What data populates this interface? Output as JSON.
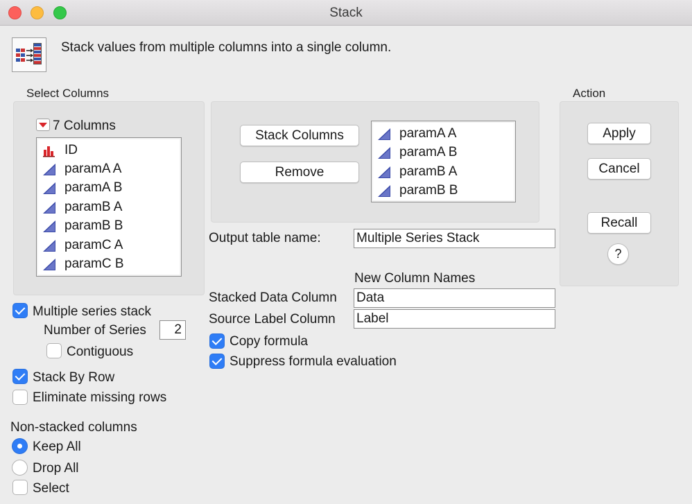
{
  "window": {
    "title": "Stack"
  },
  "description": "Stack values from multiple columns into a single column.",
  "select_columns": {
    "label": "Select Columns",
    "count_label": "7 Columns",
    "items": [
      {
        "label": "ID",
        "icon": "nominal-bar-icon"
      },
      {
        "label": "paramA A",
        "icon": "continuous-triangle-icon"
      },
      {
        "label": "paramA B",
        "icon": "continuous-triangle-icon"
      },
      {
        "label": "paramB A",
        "icon": "continuous-triangle-icon"
      },
      {
        "label": "paramB B",
        "icon": "continuous-triangle-icon"
      },
      {
        "label": "paramC A",
        "icon": "continuous-triangle-icon"
      },
      {
        "label": "paramC B",
        "icon": "continuous-triangle-icon"
      }
    ]
  },
  "buttons": {
    "stack_columns": "Stack Columns",
    "remove": "Remove"
  },
  "stacked_list": {
    "items": [
      {
        "label": "paramA A"
      },
      {
        "label": "paramA B"
      },
      {
        "label": "paramB A"
      },
      {
        "label": "paramB B"
      }
    ]
  },
  "output": {
    "label": "Output table name:",
    "value": "Multiple Series Stack"
  },
  "new_column_names": {
    "heading": "New Column Names",
    "stacked_label": "Stacked Data Column",
    "stacked_value": "Data",
    "source_label": "Source Label Column",
    "source_value": "Label"
  },
  "formula_options": {
    "copy_formula": {
      "label": "Copy formula",
      "checked": true
    },
    "suppress_eval": {
      "label": "Suppress formula evaluation",
      "checked": true
    }
  },
  "options": {
    "multiple_series": {
      "label": "Multiple series stack",
      "checked": true
    },
    "number_of_series_label": "Number of Series",
    "number_of_series_value": "2",
    "contiguous": {
      "label": "Contiguous",
      "checked": false
    },
    "stack_by_row": {
      "label": "Stack By Row",
      "checked": true
    },
    "eliminate_missing": {
      "label": "Eliminate missing rows",
      "checked": false
    }
  },
  "non_stacked": {
    "heading": "Non-stacked columns",
    "keep_all": {
      "label": "Keep All",
      "selected": true
    },
    "drop_all": {
      "label": "Drop All",
      "selected": false
    },
    "select": {
      "label": "Select",
      "checked": false
    }
  },
  "action": {
    "label": "Action",
    "apply": "Apply",
    "cancel": "Cancel",
    "recall": "Recall",
    "help": "?"
  },
  "colors": {
    "accent": "#2f7df6",
    "triangle_icon": "#3b4aa8",
    "bar_icon": "#d9262b"
  }
}
